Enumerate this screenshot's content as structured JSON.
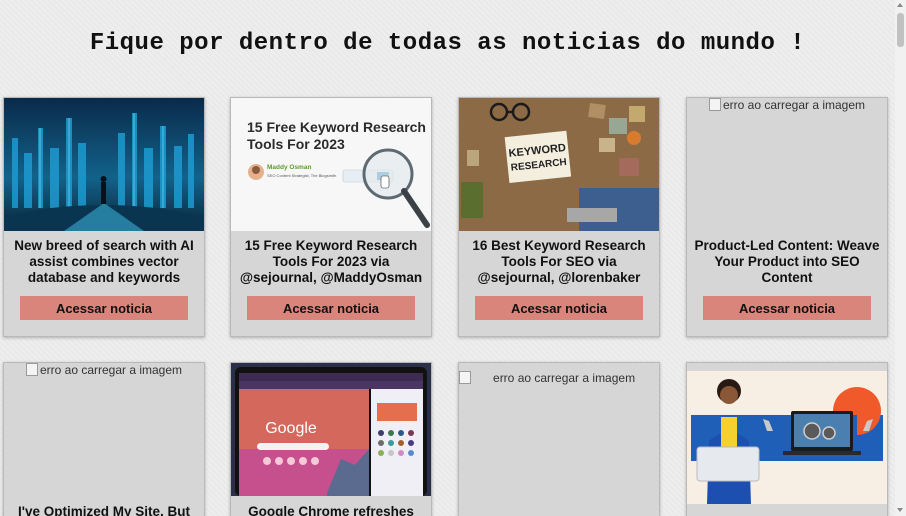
{
  "page": {
    "headline": "Fique por dentro de todas as noticias do mundo !"
  },
  "colors": {
    "button_bg": "#d9857b",
    "card_bg": "#d6d6d6",
    "page_bg": "#ededed"
  },
  "cards": [
    {
      "title": "New breed of search with AI assist combines vector database and keywords",
      "button_label": "Acessar noticia",
      "image": "futuristic-city-image"
    },
    {
      "title": "15 Free Keyword Research Tools For 2023 via @sejournal, @MaddyOsman",
      "button_label": "Acessar noticia",
      "image": "keyword-tools-banner-image",
      "image_text": {
        "heading": "15 Free Keyword Research Tools For 2023",
        "author_name": "Maddy Osman",
        "author_role": "SEO Content Strategist, The Blogsmith"
      }
    },
    {
      "title": "16 Best Keyword Research Tools For SEO via @sejournal, @lorenbaker",
      "button_label": "Acessar noticia",
      "image": "keyword-research-desk-image",
      "image_text": {
        "note": "KEYWORD RESEARCH"
      }
    },
    {
      "title": "Product-Led Content: Weave Your Product into SEO Content",
      "button_label": "Acessar noticia",
      "image_error": "erro ao carregar a imagem"
    },
    {
      "title": "I've Optimized My Site, But",
      "image_error": "erro ao carregar a imagem"
    },
    {
      "title": "Google Chrome refreshes",
      "image": "chrome-tablet-image",
      "image_text": {
        "logo": "Google"
      }
    },
    {
      "title": "",
      "image_error": "erro ao carregar a imagem"
    },
    {
      "title": "",
      "image": "woman-laptop-illustration"
    }
  ]
}
